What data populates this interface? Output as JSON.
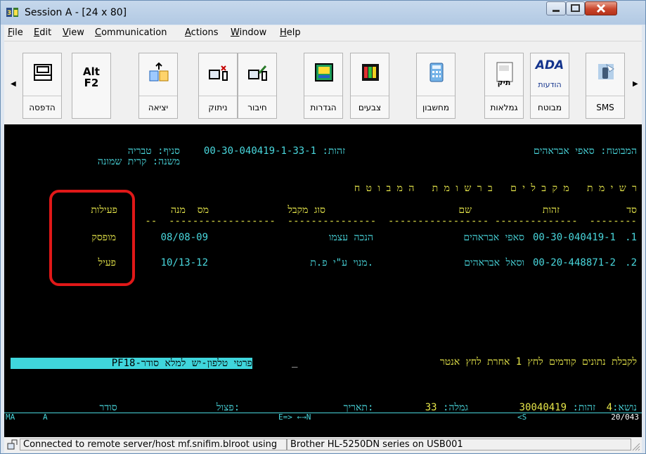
{
  "window": {
    "title": "Session A - [24 x 80]"
  },
  "menu": [
    {
      "label": "File",
      "ul": "F",
      "rest": "ile"
    },
    {
      "label": "Edit",
      "ul": "E",
      "rest": "dit"
    },
    {
      "label": "View",
      "ul": "V",
      "rest": "iew"
    },
    {
      "label": "Communication",
      "ul": "C",
      "rest": "ommunication"
    },
    {
      "label": "Actions",
      "ul": "A",
      "rest": "ctions"
    },
    {
      "label": "Window",
      "ul": "W",
      "rest": "indow"
    },
    {
      "label": "Help",
      "ul": "H",
      "rest": "elp"
    }
  ],
  "toolbar": {
    "buttons": [
      {
        "label": "הדפסה",
        "icon": "printer-icon"
      },
      {
        "label": "",
        "icon": "alt-f2-icon",
        "glyph_line1": "Alt",
        "glyph_line2": "F2"
      },
      {
        "label": "יציאה",
        "icon": "exit-icon"
      },
      {
        "label": "ניתוק",
        "icon": "disconnect-icon"
      },
      {
        "label": "חיבור",
        "icon": "connect-icon"
      },
      {
        "label": "הגדרות",
        "icon": "settings-icon"
      },
      {
        "label": "צבעים",
        "icon": "colors-icon"
      },
      {
        "label": "מחשבון",
        "icon": "calculator-icon"
      },
      {
        "label": "גמלאות",
        "icon": "pension-file-icon",
        "glyph": "תיק"
      },
      {
        "label": "מבוטח",
        "icon": "ada-icon",
        "glyph": "ADA",
        "glyph_sub": "הודעות"
      },
      {
        "label": "SMS",
        "icon": "sms-icon"
      }
    ]
  },
  "terminal": {
    "insured_label": "המבוטח:",
    "insured_name": "סאפי אבראהים",
    "id_label": "זהות:",
    "id_value": "00-30-040419-1-33-1",
    "branch_label": "סניף:",
    "branch_value": "טבריה",
    "subbranch_label": "משנה:",
    "subbranch_value": "קרית שמונה",
    "list_title": "ר ש י מ ת   מ ק ב ל י ם   ב ר ש ו מ ת   ה מ ב ו ט ח",
    "columns": {
      "num": "סד",
      "id": "זהות",
      "name": "שם",
      "type": "סוג מקבל",
      "from": "מס  מנה",
      "status": "פעילות"
    },
    "dashes": "--  ------------------  ---------------  ----------------- --------------  --------",
    "rows": [
      {
        "num": ".1",
        "id": "00-30-040419-1",
        "name": "סאפי אבראהים",
        "type": "הנכה עצמו",
        "from": "08/08-09",
        "status": "מופסק"
      },
      {
        "num": ".2",
        "id": "00-20-448871-2",
        "name": "וסאל אבראהים",
        "type": "מנוי ע\"י פ.ת.",
        "from": "10/13-12",
        "status": "פעיל"
      }
    ],
    "prompt": "לקבלת נתונים קודמים לחץ 1 אחרת לחץ אנטר",
    "cursor": "_",
    "pf_bar": "PF18-פרטי טלפון-יש למלא סודר",
    "bottom": {
      "topic_label": "נושא:",
      "topic_value": "4",
      "id_label": "זהות:",
      "id_value": "30040419",
      "pension_label": "גמלה:",
      "pension_value": "33",
      "date_label": "תאריך:",
      "date_blank": "______",
      "payment_label": "פצול:",
      "payment_blank": "__",
      "order_label": "סודר",
      "order_blank": "__"
    },
    "oia": {
      "left1": "MA",
      "left2": "A",
      "middle": "E=> ←→N",
      "right1": "<S",
      "right2": "20/043"
    }
  },
  "statusbar": {
    "connection": "Connected to remote server/host mf.snifim.blroot using",
    "printer": "Brother HL-5250DN series on USB001"
  },
  "colors": {
    "terminal_bg": "#000000",
    "cyan": "#49d7dd",
    "yellow": "#e6e64a",
    "annotation": "#e01818"
  }
}
